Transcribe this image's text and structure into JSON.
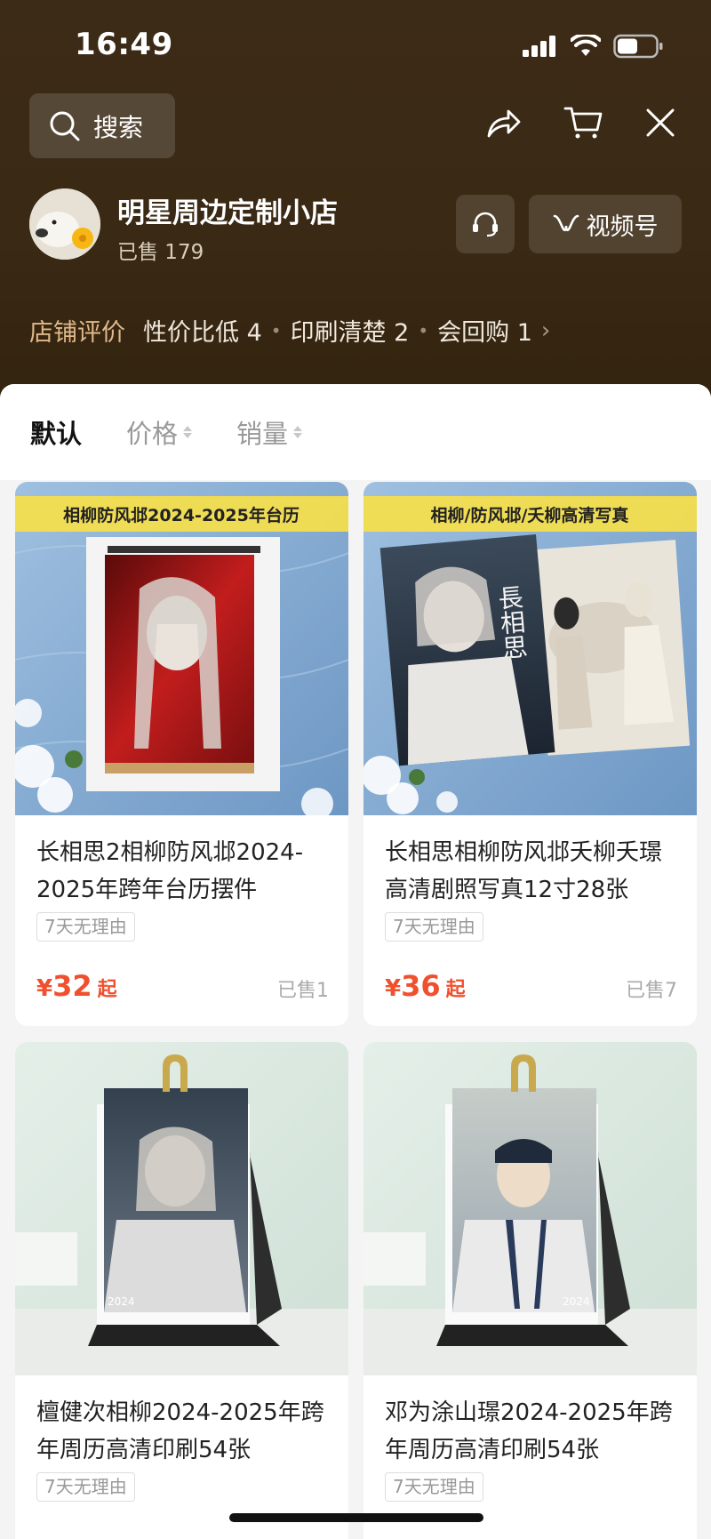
{
  "status_bar": {
    "time": "16:49"
  },
  "header": {
    "search_label": "搜索",
    "shop_name": "明星周边定制小店",
    "sold": "已售 179",
    "channel_label": "视频号",
    "review_label": "店铺评价",
    "reviews": [
      {
        "text": "性价比低 4"
      },
      {
        "text": "印刷清楚 2"
      },
      {
        "text": "会回购 1"
      }
    ]
  },
  "sort": {
    "default": "默认",
    "price": "价格",
    "sales": "销量"
  },
  "products": [
    {
      "banner": "相柳防风邶2024-2025年台历",
      "title": "长相思2相柳防风邶2024-2025年跨年台历摆件",
      "tag": "7天无理由",
      "price_symbol": "¥",
      "price": "32",
      "price_suffix": "起",
      "sold": "已售1"
    },
    {
      "banner": "相柳/防风邶/夭柳高清写真",
      "title": "长相思相柳防风邶夭柳夭璟高清剧照写真12寸28张",
      "tag": "7天无理由",
      "price_symbol": "¥",
      "price": "36",
      "price_suffix": "起",
      "sold": "已售7"
    },
    {
      "title": "檀健次相柳2024-2025年跨年周历高清印刷54张",
      "tag": "7天无理由"
    },
    {
      "title": "邓为涂山璟2024-2025年跨年周历高清印刷54张",
      "tag": "7天无理由"
    }
  ],
  "poster_text": {
    "vertical_title": "長相思",
    "year": "2024"
  },
  "colors": {
    "header_bg": "#3c2b16",
    "price": "#f0502e",
    "review_label": "#e0b98a"
  }
}
